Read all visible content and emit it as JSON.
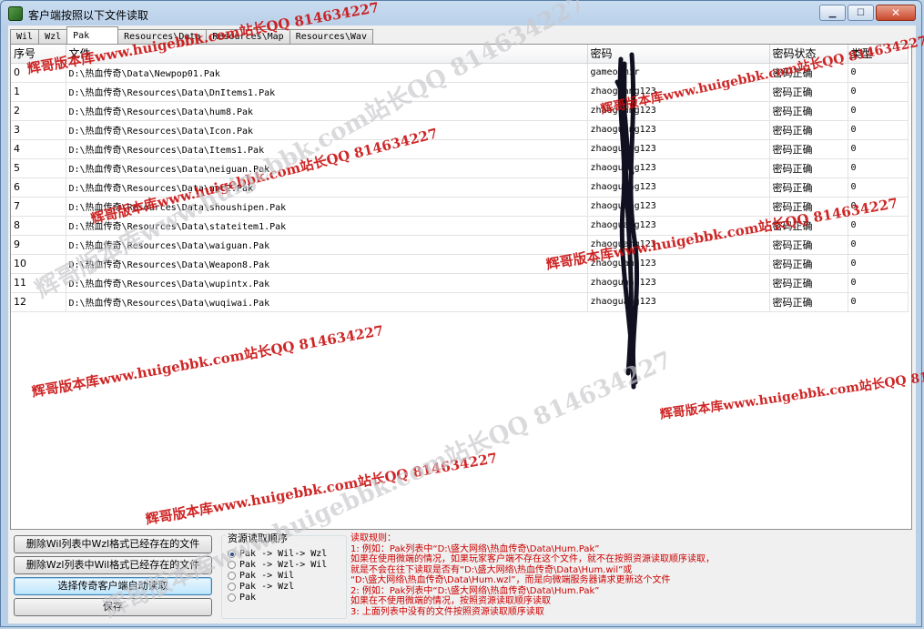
{
  "window": {
    "title": "客户端按照以下文件读取"
  },
  "tabs": [
    {
      "label": "Wil",
      "active": false
    },
    {
      "label": "Wzl",
      "active": false
    },
    {
      "label": "Pak",
      "active": true
    },
    {
      "label": "Resources\\Data",
      "active": false
    },
    {
      "label": "Resources\\Map",
      "active": false
    },
    {
      "label": "Resources\\Wav",
      "active": false
    }
  ],
  "table": {
    "columns": [
      "序号",
      "文件",
      "密码",
      "密码状态",
      "类型"
    ],
    "rows": [
      [
        "0",
        "D:\\热血传奇\\Data\\Newpop01.Pak",
        "gameofmir",
        "密码正确",
        "0"
      ],
      [
        "1",
        "D:\\热血传奇\\Resources\\Data\\DnItems1.Pak",
        "zhaoguang123",
        "密码正确",
        "0"
      ],
      [
        "2",
        "D:\\热血传奇\\Resources\\Data\\hum8.Pak",
        "zhaoguang123",
        "密码正确",
        "0"
      ],
      [
        "3",
        "D:\\热血传奇\\Resources\\Data\\Icon.Pak",
        "zhaoguang123",
        "密码正确",
        "0"
      ],
      [
        "4",
        "D:\\热血传奇\\Resources\\Data\\Items1.Pak",
        "zhaoguang123",
        "密码正确",
        "0"
      ],
      [
        "5",
        "D:\\热血传奇\\Resources\\Data\\neiguan.Pak",
        "zhaoguang123",
        "密码正确",
        "0"
      ],
      [
        "6",
        "D:\\热血传奇\\Resources\\Data\\npc2.Pak",
        "zhaoguang123",
        "密码正确",
        "0"
      ],
      [
        "7",
        "D:\\热血传奇\\Resources\\Data\\shoushipen.Pak",
        "zhaoguang123",
        "密码正确",
        "0"
      ],
      [
        "8",
        "D:\\热血传奇\\Resources\\Data\\stateitem1.Pak",
        "zhaoguang123",
        "密码正确",
        "0"
      ],
      [
        "9",
        "D:\\热血传奇\\Resources\\Data\\waiguan.Pak",
        "zhaoguang123",
        "密码正确",
        "0"
      ],
      [
        "10",
        "D:\\热血传奇\\Resources\\Data\\Weapon8.Pak",
        "zhaoguang123",
        "密码正确",
        "0"
      ],
      [
        "11",
        "D:\\热血传奇\\Resources\\Data\\wupintx.Pak",
        "zhaoguang123",
        "密码正确",
        "0"
      ],
      [
        "12",
        "D:\\热血传奇\\Resources\\Data\\wuqiwai.Pak",
        "zhaoguang123",
        "密码正确",
        "0"
      ]
    ]
  },
  "buttons": {
    "delete_wil": "删除Wil列表中Wzl格式已经存在的文件",
    "delete_wzl": "删除Wzl列表中Wil格式已经存在的文件",
    "auto_read": "选择传奇客户端自动读取",
    "save": "保存"
  },
  "resource_order": {
    "title": "资源读取顺序",
    "options": [
      {
        "label": "Pak -> Wil-> Wzl",
        "selected": true
      },
      {
        "label": "Pak -> Wzl-> Wil",
        "selected": false
      },
      {
        "label": "Pak -> Wil",
        "selected": false
      },
      {
        "label": "Pak -> Wzl",
        "selected": false
      },
      {
        "label": "Pak",
        "selected": false
      }
    ]
  },
  "rules": {
    "title": "读取规则：",
    "lines": [
      "1: 例如：Pak列表中“D:\\盛大网络\\热血传奇\\Data\\Hum.Pak”",
      "    如果在使用微端的情况，如果玩家客户端不存在这个文件，就不在按照资源读取顺序读取，",
      "    就是不会在往下读取是否有“D:\\盛大网络\\热血传奇\\Data\\Hum.wil”或",
      "    “D:\\盛大网络\\热血传奇\\Data\\Hum.wzl”，而是向微端服务器请求更新这个文件",
      "2: 例如：Pak列表中“D:\\盛大网络\\热血传奇\\Data\\Hum.Pak”",
      "    如果在不使用微端的情况，按照资源读取顺序读取",
      "3: 上面列表中没有的文件按照资源读取顺序读取"
    ]
  },
  "watermarks": [
    "辉哥版本库www.huigebbk.com站长QQ 814634227",
    "辉哥版本库www.huigebbk.com站长QQ 814634227",
    "辉哥版本库www.huigebbk.com站长QQ 814634227",
    "辉哥版本库www.huigebbk.com站长QQ 814634227",
    "辉哥版本库www.huigebbk.com站长QQ 814634227",
    "辉哥版本库www.huigebbk.com站长QQ 814634227",
    "辉哥版本库www.huigebbk.com站长QQ 814634227",
    "辉哥版本库www.huigebbk.com站长QQ 814634227",
    "辉哥版本库www.huigebbk.com站长QQ 814634227"
  ],
  "colors": {
    "rules_text": "#cc0000",
    "watermark": "#c91010",
    "title_bar": "#c9dcf0"
  }
}
